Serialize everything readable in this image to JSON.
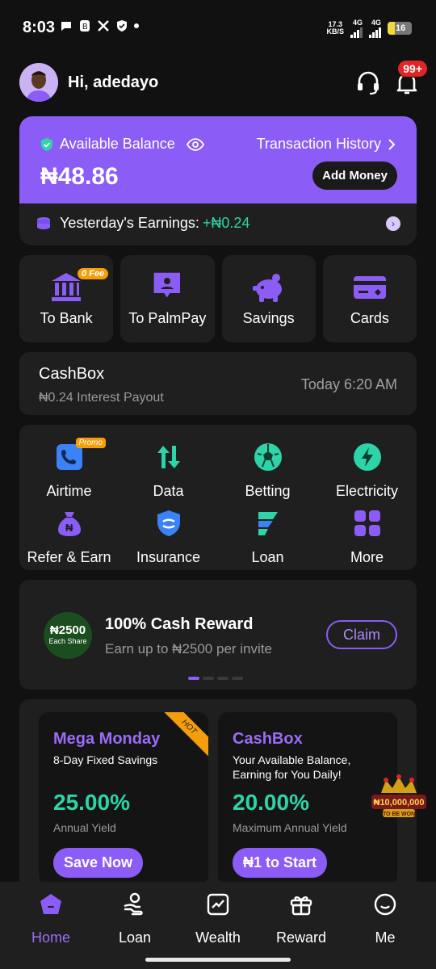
{
  "status_bar": {
    "time": "8:03",
    "net_speed_value": "17.3",
    "net_speed_unit": "KB/S",
    "network1": "4G",
    "network2": "4G",
    "battery": "16"
  },
  "header": {
    "greeting": "Hi, adedayo",
    "notification_badge": "99+"
  },
  "balance": {
    "label": "Available Balance",
    "amount": "₦48.86",
    "history_link": "Transaction History",
    "add_money": "Add Money",
    "earnings_label": "Yesterday's Earnings:",
    "earnings_value": "+₦0.24"
  },
  "quick_actions": [
    {
      "label": "To Bank",
      "icon": "bank-icon",
      "tag": "0 Fee"
    },
    {
      "label": "To PalmPay",
      "icon": "user-chat-icon"
    },
    {
      "label": "Savings",
      "icon": "piggy-bank-icon"
    },
    {
      "label": "Cards",
      "icon": "card-icon"
    }
  ],
  "cashbox": {
    "title": "CashBox",
    "subtitle": "₦0.24 Interest Payout",
    "time": "Today 6:20 AM"
  },
  "services": [
    {
      "label": "Airtime",
      "icon": "phone-icon",
      "tag": "Promo"
    },
    {
      "label": "Data",
      "icon": "data-arrows-icon"
    },
    {
      "label": "Betting",
      "icon": "soccer-ball-icon"
    },
    {
      "label": "Electricity",
      "icon": "lightning-icon"
    },
    {
      "label": "Refer & Earn",
      "icon": "money-bag-icon"
    },
    {
      "label": "Insurance",
      "icon": "shield-icon"
    },
    {
      "label": "Loan",
      "icon": "loan-icon"
    },
    {
      "label": "More",
      "icon": "grid-icon"
    }
  ],
  "reward": {
    "coin_amount": "₦2500",
    "coin_caption": "Each Share",
    "title": "100% Cash Reward",
    "subtitle": "Earn up to ₦2500 per invite",
    "claim": "Claim"
  },
  "savings": [
    {
      "title": "Mega Monday",
      "subtitle": "8-Day Fixed Savings",
      "rate": "25.00%",
      "rate_label": "Annual Yield",
      "button": "Save Now",
      "ribbon": "HOT"
    },
    {
      "title": "CashBox",
      "subtitle": "Your Available Balance, Earning for You Daily!",
      "rate": "20.00%",
      "rate_label": "Maximum Annual Yield",
      "button": "₦1 to Start"
    }
  ],
  "prize_badge": {
    "amount": "₦10,000,000",
    "caption": "TO BE WON"
  },
  "nav": [
    {
      "label": "Home",
      "icon": "home-icon",
      "active": true
    },
    {
      "label": "Loan",
      "icon": "loan-hand-icon"
    },
    {
      "label": "Wealth",
      "icon": "chart-icon"
    },
    {
      "label": "Reward",
      "icon": "gift-icon"
    },
    {
      "label": "Me",
      "icon": "smile-icon"
    }
  ],
  "colors": {
    "accent": "#8b5cf6",
    "positive": "#2dd4a7",
    "background": "#111111",
    "card": "#1f1f1f",
    "badge": "#e02525",
    "tag": "#f59e0b"
  }
}
